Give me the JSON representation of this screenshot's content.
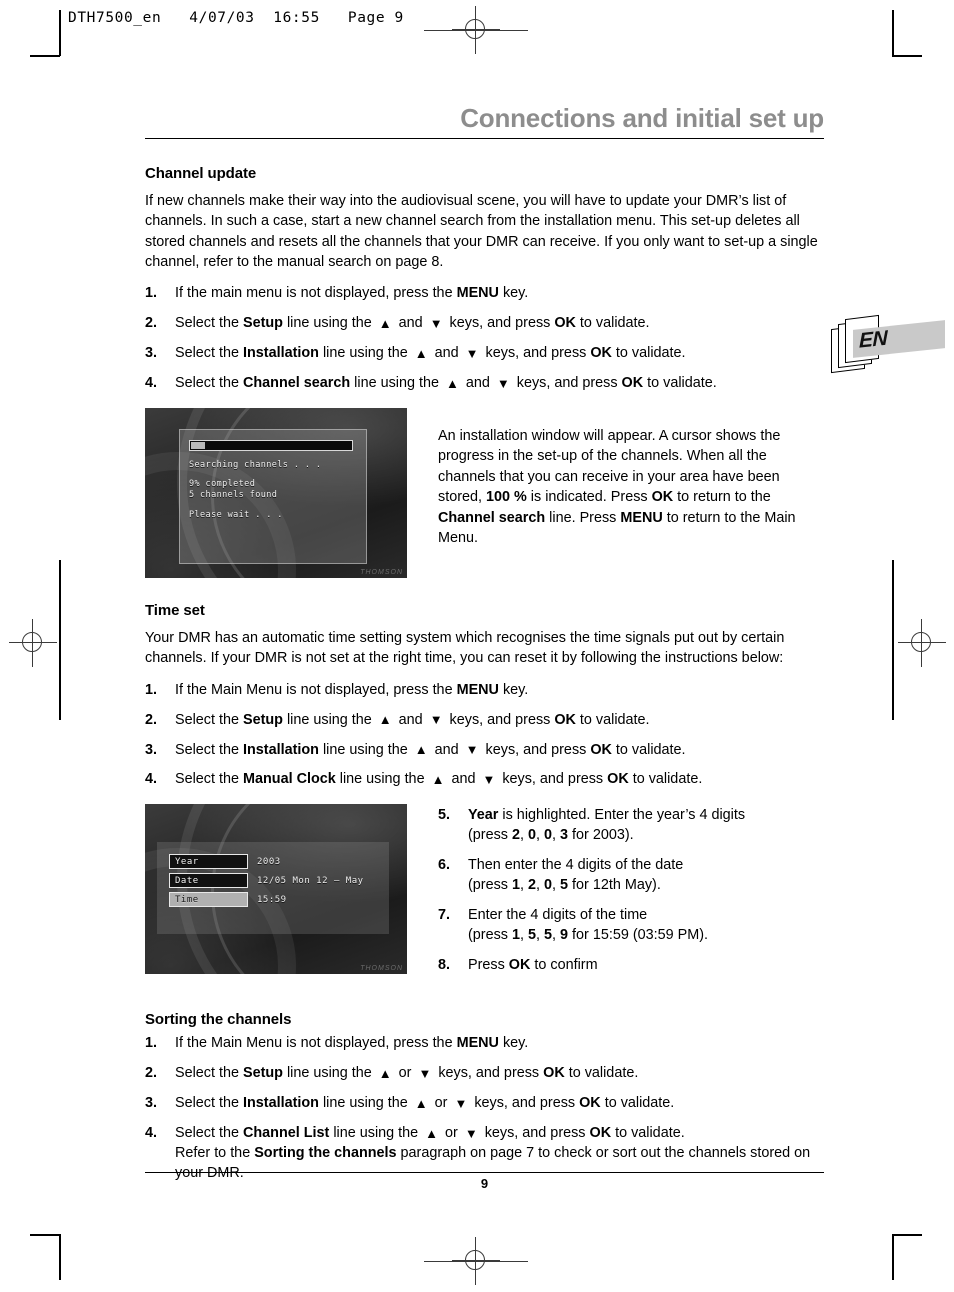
{
  "file_header": "DTH7500_en   4/07/03  16:55   Page 9",
  "chapter_title": "Connections and initial set up",
  "language_tab": "EN",
  "page_number": "9",
  "sections": {
    "channel_update": {
      "heading": "Channel update",
      "intro": "If new channels make their way into the audiovisual scene, you will have to update your DMR’s list of channels. In such a case, start a new channel search from the installation menu. This set-up deletes all stored channels and resets all the channels that your DMR can receive. If you only want to set-up a single channel, refer to the manual search on page 8.",
      "steps": [
        {
          "num": "1.",
          "p1": "If the main menu is not displayed, press the ",
          "strong1": "MENU",
          "p2": " key."
        },
        {
          "num": "2.",
          "p1": "Select the ",
          "strong1": "Setup",
          "p2": " line using the ",
          "arrow_up": "▲",
          "p3": " and ",
          "arrow_down": "▼",
          "p4": " keys, and press ",
          "strong2": "OK",
          "p5": " to validate."
        },
        {
          "num": "3.",
          "p1": "Select the ",
          "strong1": "Installation",
          "p2": " line using the ",
          "arrow_up": "▲",
          "p3": " and ",
          "arrow_down": "▼",
          "p4": " keys, and press ",
          "strong2": "OK",
          "p5": " to validate."
        },
        {
          "num": "4.",
          "p1": "Select the ",
          "strong1": "Channel search",
          "p2": " line using the ",
          "arrow_up": "▲",
          "p3": " and ",
          "arrow_down": "▼",
          "p4": " keys, and press ",
          "strong2": "OK",
          "p5": " to validate."
        }
      ],
      "figure": {
        "screen_title": "Searching channels . . .",
        "percent_completed": "9% completed",
        "channels_found": "5 channels found",
        "please_wait": "Please wait . . .",
        "progress_percent": 9,
        "brand_mark": "THOMSON"
      },
      "caption": {
        "p1": "An installation window will appear. A cursor shows the progress in the set-up of the channels. When all the channels that you can receive in your area have been stored, ",
        "strong1": "100 %",
        "p2": " is indicated. Press ",
        "strong2": "OK",
        "p3": " to return to the ",
        "strong3": "Channel search",
        "p4": " line. Press ",
        "strong4": "MENU",
        "p5": " to return to the Main Menu."
      }
    },
    "time_set": {
      "heading": "Time set",
      "intro": "Your DMR has an automatic time setting system which recognises the time signals put out by certain channels. If your DMR is not set at the right time, you can reset it by following the instructions below:",
      "steps": [
        {
          "num": "1.",
          "p1": "If the Main Menu is not displayed, press the ",
          "strong1": "MENU",
          "p2": " key."
        },
        {
          "num": "2.",
          "p1": "Select the ",
          "strong1": "Setup",
          "p2": " line using the ",
          "arrow_up": "▲",
          "p3": " and ",
          "arrow_down": "▼",
          "p4": " keys, and press ",
          "strong2": "OK",
          "p5": " to validate."
        },
        {
          "num": "3.",
          "p1": "Select the ",
          "strong1": "Installation",
          "p2": " line using the ",
          "arrow_up": "▲",
          "p3": " and ",
          "arrow_down": "▼",
          "p4": " keys, and press ",
          "strong2": "OK",
          "p5": " to validate."
        },
        {
          "num": "4.",
          "p1": "Select the ",
          "strong1": "Manual Clock",
          "p2": " line using the ",
          "arrow_up": "▲",
          "p3": " and ",
          "arrow_down": "▼",
          "p4": " keys, and press ",
          "strong2": "OK",
          "p5": " to validate."
        }
      ],
      "figure": {
        "rows": [
          {
            "label": "Year",
            "value": "2003",
            "selected": false
          },
          {
            "label": "Date",
            "value": "12/05  Mon 12 – May",
            "selected": false
          },
          {
            "label": "Time",
            "value": "15:59",
            "selected": true
          }
        ],
        "brand_mark": "THOMSON"
      },
      "steps_right": [
        {
          "num": "5.",
          "strong1": "Year",
          "p1": " is highlighted. Enter the year’s 4 digits",
          "sub_pre": "(press ",
          "d1": "2",
          "s1": ", ",
          "d2": "0",
          "s2": ", ",
          "d3": "0",
          "s3": ", ",
          "d4": "3",
          "sub_post": " for 2003)."
        },
        {
          "num": "6.",
          "strong1": "",
          "p1": "Then enter the 4 digits of the date",
          "sub_pre": "(press ",
          "d1": "1",
          "s1": ", ",
          "d2": "2",
          "s2": ", ",
          "d3": "0",
          "s3": ", ",
          "d4": "5",
          "sub_post": " for 12th May)."
        },
        {
          "num": "7.",
          "strong1": "",
          "p1": "Enter the 4 digits of the time",
          "sub_pre": "(press ",
          "d1": "1",
          "s1": ", ",
          "d2": "5",
          "s2": ", ",
          "d3": "5",
          "s3": ", ",
          "d4": "9",
          "sub_post": " for 15:59 (03:59 PM)."
        },
        {
          "num": "8.",
          "p1": "Press ",
          "strong1": "OK",
          "p2": " to confirm"
        }
      ]
    },
    "sorting_channels": {
      "heading": "Sorting the channels",
      "steps": [
        {
          "num": "1.",
          "p1": "If the Main Menu is not displayed, press the ",
          "strong1": "MENU",
          "p2": " key."
        },
        {
          "num": "2.",
          "p1": "Select the ",
          "strong1": "Setup",
          "p2": " line using the ",
          "arrow_up": "▲",
          "p3": " or ",
          "arrow_down": "▼",
          "p4": " keys, and press ",
          "strong2": "OK",
          "p5": " to validate."
        },
        {
          "num": "3.",
          "p1": "Select the ",
          "strong1": "Installation",
          "p2": " line using the ",
          "arrow_up": "▲",
          "p3": " or ",
          "arrow_down": "▼",
          "p4": " keys, and press ",
          "strong2": "OK",
          "p5": " to validate."
        },
        {
          "num": "4.",
          "p1": "Select the ",
          "strong1": "Channel List",
          "p2": " line using the ",
          "arrow_up": "▲",
          "p3": " or ",
          "arrow_down": "▼",
          "p4": " keys, and press ",
          "strong2": "OK",
          "p5": " to validate.",
          "sub_p1": "Refer to the ",
          "sub_strong": "Sorting the channels",
          "sub_p2": " paragraph on page 7 to check or sort out the channels stored on your DMR."
        }
      ]
    }
  }
}
